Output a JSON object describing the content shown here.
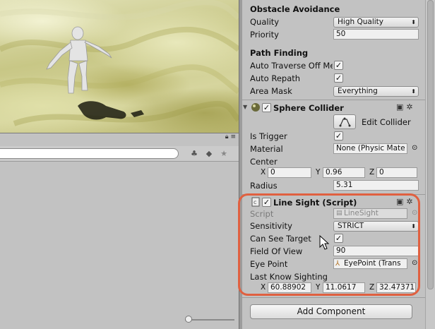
{
  "scene": {
    "icon": "humanoid-character"
  },
  "project_panel": {
    "tab_strip_icons": [
      "lock-icon",
      "menu-icon"
    ],
    "search_placeholder": "",
    "toolbar_icons": [
      "filter-by-type-icon",
      "filter-by-label-icon",
      "favorite-star-icon"
    ],
    "zoom_slider_value": 0
  },
  "inspector": {
    "obstacle_avoidance": {
      "header": "Obstacle Avoidance",
      "quality_label": "Quality",
      "quality_value": "High Quality",
      "priority_label": "Priority",
      "priority_value": "50"
    },
    "path_finding": {
      "header": "Path Finding",
      "auto_traverse_label": "Auto Traverse Off Me",
      "auto_traverse_checked": "✓",
      "auto_repath_label": "Auto Repath",
      "auto_repath_checked": "✓",
      "area_mask_label": "Area Mask",
      "area_mask_value": "Everything"
    },
    "sphere_collider": {
      "title": "Sphere Collider",
      "enabled_check": "✓",
      "edit_collider_label": "Edit Collider",
      "is_trigger_label": "Is Trigger",
      "is_trigger_checked": "✓",
      "material_label": "Material",
      "material_value": "None (Physic Mate",
      "center_label": "Center",
      "center_x_label": "X",
      "center_x": "0",
      "center_y_label": "Y",
      "center_y": "0.96",
      "center_z_label": "Z",
      "center_z": "0",
      "radius_label": "Radius",
      "radius_value": "5.31"
    },
    "line_sight": {
      "title": "Line Sight (Script)",
      "enabled_check": "✓",
      "script_label": "Script",
      "script_value": "LineSight",
      "sensitivity_label": "Sensitivity",
      "sensitivity_value": "STRICT",
      "can_see_target_label": "Can See Target",
      "can_see_target_checked": "✓",
      "field_of_view_label": "Field Of View",
      "field_of_view_value": "90",
      "eye_point_label": "Eye Point",
      "eye_point_value": "EyePoint (Trans",
      "last_know_sighting_label": "Last Know Sighting",
      "lks_x_label": "X",
      "lks_x": "60.88902",
      "lks_y_label": "Y",
      "lks_y": "11.0617",
      "lks_z_label": "Z",
      "lks_z": "32.47371"
    },
    "add_component_label": "Add Component",
    "highlight_color": "#e06040"
  }
}
